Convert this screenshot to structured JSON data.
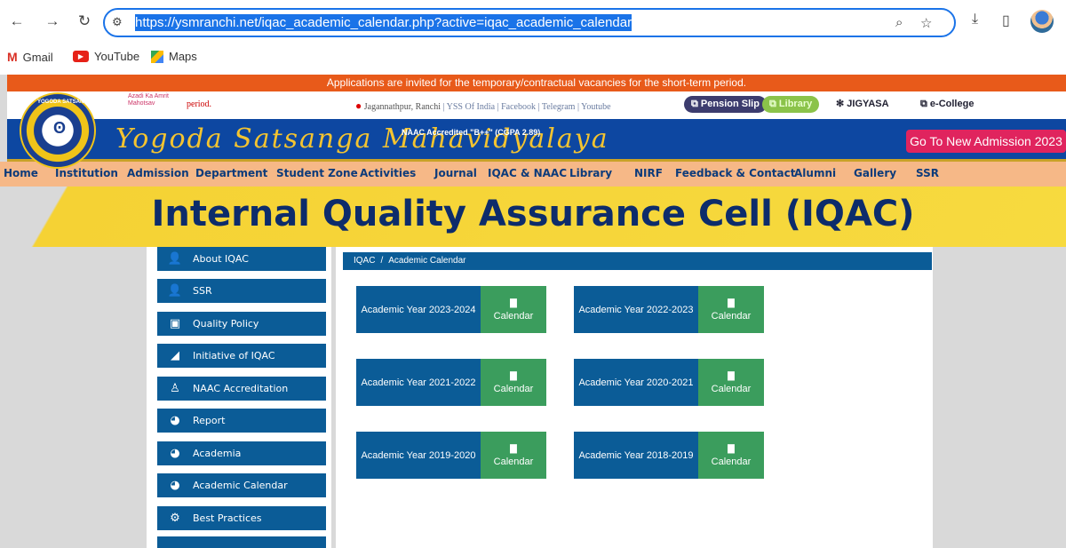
{
  "browser": {
    "url": "https://ysmranchi.net/iqac_academic_calendar.php?active=iqac_academic_calendar",
    "bookmarks": [
      "Gmail",
      "YouTube",
      "Maps"
    ],
    "icons": [
      "back-icon",
      "forward-icon",
      "reload-icon",
      "site-info-icon",
      "zoom-icon",
      "star-icon",
      "download-icon",
      "sidepanel-icon"
    ]
  },
  "ticker": "Applications are invited for the temporary/contractual vacancies for the short-term period.",
  "topstrip": {
    "azadi_text": "Azadi Ka Amrit Mahotsav",
    "period_text": "period.",
    "location": "Jagannathpur, Ranchi",
    "links": [
      "YSS Of India",
      "Facebook",
      "Telegram",
      "Youtube"
    ],
    "pension_slip": "Pension Slip",
    "library": "Library",
    "jigyasa": "JIGYASA",
    "ecollege": "e-College"
  },
  "banner": {
    "logo_text": "YOGODA SATSANGA",
    "college_name": "Yogoda Satsanga Mahavidyalaya",
    "naac": "NAAC Accredited \"B++\" (CGPA 2.89)",
    "admission_button": "Go To New Admission 2023"
  },
  "nav": [
    "Home",
    "Institution",
    "Admission",
    "Department",
    "Student Zone",
    "Activities",
    "Journal",
    "IQAC & NAAC",
    "Library",
    "NIRF",
    "Feedback & Contact",
    "Alumni",
    "Gallery",
    "SSR"
  ],
  "hero_title": "Internal Quality Assurance Cell (IQAC)",
  "sidebar": [
    {
      "label": "About IQAC",
      "icon": "users-icon"
    },
    {
      "label": "SSR",
      "icon": "users-icon"
    },
    {
      "label": "Quality Policy",
      "icon": "document-icon"
    },
    {
      "label": "Initiative of IQAC",
      "icon": "handshake-icon"
    },
    {
      "label": "NAAC Accreditation",
      "icon": "award-icon"
    },
    {
      "label": "Report",
      "icon": "pie-chart-icon"
    },
    {
      "label": "Academia",
      "icon": "pie-chart-icon"
    },
    {
      "label": "Academic Calendar",
      "icon": "pie-chart-icon"
    },
    {
      "label": "Best Practices",
      "icon": "gears-icon"
    }
  ],
  "breadcrumb": {
    "root": "IQAC",
    "separator": "/",
    "current": "Academic Calendar"
  },
  "calendars": [
    {
      "year": "Academic Year 2023-2024",
      "link": "Calendar"
    },
    {
      "year": "Academic Year 2022-2023",
      "link": "Calendar"
    },
    {
      "year": "Academic Year 2021-2022",
      "link": "Calendar"
    },
    {
      "year": "Academic Year 2020-2021",
      "link": "Calendar"
    },
    {
      "year": "Academic Year 2019-2020",
      "link": "Calendar"
    },
    {
      "year": "Academic Year 2018-2019",
      "link": "Calendar"
    }
  ]
}
